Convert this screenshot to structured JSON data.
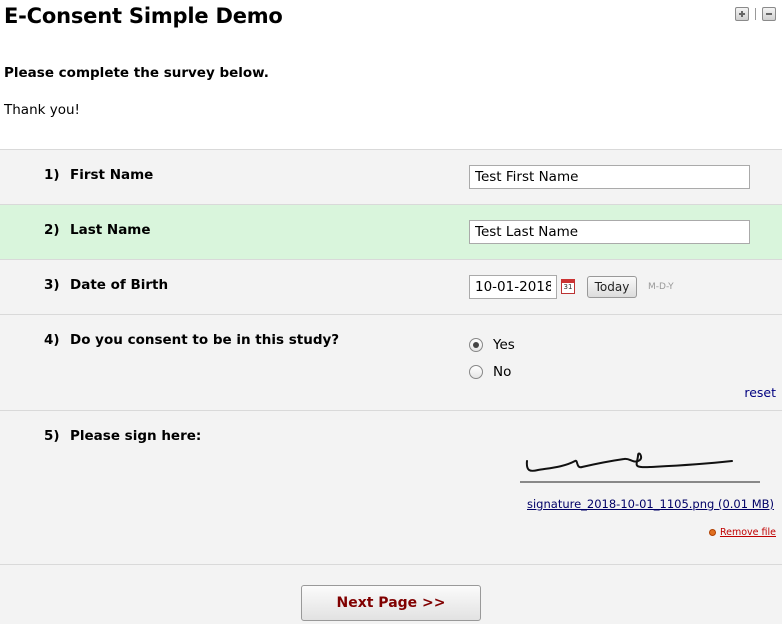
{
  "survey": {
    "title": "E-Consent Simple Demo",
    "intro_bold": "Please complete the survey below.",
    "intro_thanks": "Thank you!"
  },
  "questions": {
    "q1": {
      "num": "1)",
      "label": "First Name",
      "value": "Test First Name"
    },
    "q2": {
      "num": "2)",
      "label": "Last Name",
      "value": "Test Last Name"
    },
    "q3": {
      "num": "3)",
      "label": "Date of Birth",
      "value": "10-01-2018",
      "today_label": "Today",
      "format_hint": "M-D-Y",
      "calendar_day": "31"
    },
    "q4": {
      "num": "4)",
      "label": "Do you consent to be in this study?",
      "options": [
        "Yes",
        "No"
      ],
      "selected": "Yes",
      "reset_label": "reset"
    },
    "q5": {
      "num": "5)",
      "label": "Please sign here:",
      "file_link": "signature_2018-10-01_1105.png (0.01 MB)",
      "remove_label": "Remove file"
    }
  },
  "navigation": {
    "next_label": "Next Page >>"
  },
  "icons": {
    "expand": "plus-square-icon",
    "collapse": "minus-square-icon",
    "calendar": "calendar-icon",
    "remove": "remove-dot-icon"
  },
  "colors": {
    "highlight_row": "#d9f5dc",
    "row_bg": "#f3f3f3",
    "next_button_text": "#800000",
    "link": "#000080"
  }
}
